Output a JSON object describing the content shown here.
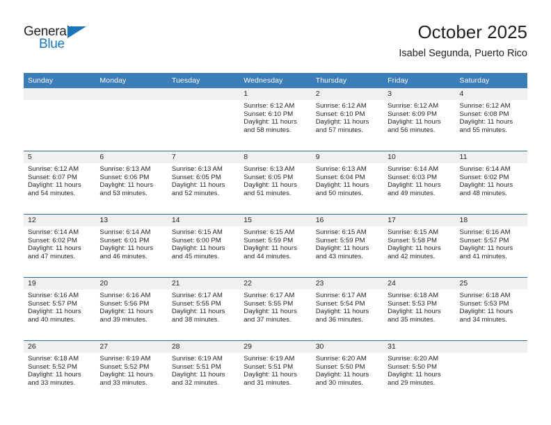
{
  "brand": {
    "name_part1": "General",
    "name_part2": "Blue"
  },
  "header": {
    "title": "October 2025",
    "subtitle": "Isabel Segunda, Puerto Rico"
  },
  "weekday_headers": [
    "Sunday",
    "Monday",
    "Tuesday",
    "Wednesday",
    "Thursday",
    "Friday",
    "Saturday"
  ],
  "colors": {
    "header_blue": "#3b7cb9",
    "row_divider_blue": "#2e6da4",
    "daynum_band": "#f0f0f0",
    "brand_blue": "#1b75bb",
    "text": "#231f20"
  },
  "weeks": [
    [
      {
        "day": "",
        "empty": true
      },
      {
        "day": "",
        "empty": true
      },
      {
        "day": "",
        "empty": true
      },
      {
        "day": "1",
        "sunrise": "Sunrise: 6:12 AM",
        "sunset": "Sunset: 6:10 PM",
        "daylight_line1": "Daylight: 11 hours",
        "daylight_line2": "and 58 minutes."
      },
      {
        "day": "2",
        "sunrise": "Sunrise: 6:12 AM",
        "sunset": "Sunset: 6:10 PM",
        "daylight_line1": "Daylight: 11 hours",
        "daylight_line2": "and 57 minutes."
      },
      {
        "day": "3",
        "sunrise": "Sunrise: 6:12 AM",
        "sunset": "Sunset: 6:09 PM",
        "daylight_line1": "Daylight: 11 hours",
        "daylight_line2": "and 56 minutes."
      },
      {
        "day": "4",
        "sunrise": "Sunrise: 6:12 AM",
        "sunset": "Sunset: 6:08 PM",
        "daylight_line1": "Daylight: 11 hours",
        "daylight_line2": "and 55 minutes."
      }
    ],
    [
      {
        "day": "5",
        "sunrise": "Sunrise: 6:12 AM",
        "sunset": "Sunset: 6:07 PM",
        "daylight_line1": "Daylight: 11 hours",
        "daylight_line2": "and 54 minutes."
      },
      {
        "day": "6",
        "sunrise": "Sunrise: 6:13 AM",
        "sunset": "Sunset: 6:06 PM",
        "daylight_line1": "Daylight: 11 hours",
        "daylight_line2": "and 53 minutes."
      },
      {
        "day": "7",
        "sunrise": "Sunrise: 6:13 AM",
        "sunset": "Sunset: 6:05 PM",
        "daylight_line1": "Daylight: 11 hours",
        "daylight_line2": "and 52 minutes."
      },
      {
        "day": "8",
        "sunrise": "Sunrise: 6:13 AM",
        "sunset": "Sunset: 6:05 PM",
        "daylight_line1": "Daylight: 11 hours",
        "daylight_line2": "and 51 minutes."
      },
      {
        "day": "9",
        "sunrise": "Sunrise: 6:13 AM",
        "sunset": "Sunset: 6:04 PM",
        "daylight_line1": "Daylight: 11 hours",
        "daylight_line2": "and 50 minutes."
      },
      {
        "day": "10",
        "sunrise": "Sunrise: 6:14 AM",
        "sunset": "Sunset: 6:03 PM",
        "daylight_line1": "Daylight: 11 hours",
        "daylight_line2": "and 49 minutes."
      },
      {
        "day": "11",
        "sunrise": "Sunrise: 6:14 AM",
        "sunset": "Sunset: 6:02 PM",
        "daylight_line1": "Daylight: 11 hours",
        "daylight_line2": "and 48 minutes."
      }
    ],
    [
      {
        "day": "12",
        "sunrise": "Sunrise: 6:14 AM",
        "sunset": "Sunset: 6:02 PM",
        "daylight_line1": "Daylight: 11 hours",
        "daylight_line2": "and 47 minutes."
      },
      {
        "day": "13",
        "sunrise": "Sunrise: 6:14 AM",
        "sunset": "Sunset: 6:01 PM",
        "daylight_line1": "Daylight: 11 hours",
        "daylight_line2": "and 46 minutes."
      },
      {
        "day": "14",
        "sunrise": "Sunrise: 6:15 AM",
        "sunset": "Sunset: 6:00 PM",
        "daylight_line1": "Daylight: 11 hours",
        "daylight_line2": "and 45 minutes."
      },
      {
        "day": "15",
        "sunrise": "Sunrise: 6:15 AM",
        "sunset": "Sunset: 5:59 PM",
        "daylight_line1": "Daylight: 11 hours",
        "daylight_line2": "and 44 minutes."
      },
      {
        "day": "16",
        "sunrise": "Sunrise: 6:15 AM",
        "sunset": "Sunset: 5:59 PM",
        "daylight_line1": "Daylight: 11 hours",
        "daylight_line2": "and 43 minutes."
      },
      {
        "day": "17",
        "sunrise": "Sunrise: 6:15 AM",
        "sunset": "Sunset: 5:58 PM",
        "daylight_line1": "Daylight: 11 hours",
        "daylight_line2": "and 42 minutes."
      },
      {
        "day": "18",
        "sunrise": "Sunrise: 6:16 AM",
        "sunset": "Sunset: 5:57 PM",
        "daylight_line1": "Daylight: 11 hours",
        "daylight_line2": "and 41 minutes."
      }
    ],
    [
      {
        "day": "19",
        "sunrise": "Sunrise: 6:16 AM",
        "sunset": "Sunset: 5:57 PM",
        "daylight_line1": "Daylight: 11 hours",
        "daylight_line2": "and 40 minutes."
      },
      {
        "day": "20",
        "sunrise": "Sunrise: 6:16 AM",
        "sunset": "Sunset: 5:56 PM",
        "daylight_line1": "Daylight: 11 hours",
        "daylight_line2": "and 39 minutes."
      },
      {
        "day": "21",
        "sunrise": "Sunrise: 6:17 AM",
        "sunset": "Sunset: 5:55 PM",
        "daylight_line1": "Daylight: 11 hours",
        "daylight_line2": "and 38 minutes."
      },
      {
        "day": "22",
        "sunrise": "Sunrise: 6:17 AM",
        "sunset": "Sunset: 5:55 PM",
        "daylight_line1": "Daylight: 11 hours",
        "daylight_line2": "and 37 minutes."
      },
      {
        "day": "23",
        "sunrise": "Sunrise: 6:17 AM",
        "sunset": "Sunset: 5:54 PM",
        "daylight_line1": "Daylight: 11 hours",
        "daylight_line2": "and 36 minutes."
      },
      {
        "day": "24",
        "sunrise": "Sunrise: 6:18 AM",
        "sunset": "Sunset: 5:53 PM",
        "daylight_line1": "Daylight: 11 hours",
        "daylight_line2": "and 35 minutes."
      },
      {
        "day": "25",
        "sunrise": "Sunrise: 6:18 AM",
        "sunset": "Sunset: 5:53 PM",
        "daylight_line1": "Daylight: 11 hours",
        "daylight_line2": "and 34 minutes."
      }
    ],
    [
      {
        "day": "26",
        "sunrise": "Sunrise: 6:18 AM",
        "sunset": "Sunset: 5:52 PM",
        "daylight_line1": "Daylight: 11 hours",
        "daylight_line2": "and 33 minutes."
      },
      {
        "day": "27",
        "sunrise": "Sunrise: 6:19 AM",
        "sunset": "Sunset: 5:52 PM",
        "daylight_line1": "Daylight: 11 hours",
        "daylight_line2": "and 33 minutes."
      },
      {
        "day": "28",
        "sunrise": "Sunrise: 6:19 AM",
        "sunset": "Sunset: 5:51 PM",
        "daylight_line1": "Daylight: 11 hours",
        "daylight_line2": "and 32 minutes."
      },
      {
        "day": "29",
        "sunrise": "Sunrise: 6:19 AM",
        "sunset": "Sunset: 5:51 PM",
        "daylight_line1": "Daylight: 11 hours",
        "daylight_line2": "and 31 minutes."
      },
      {
        "day": "30",
        "sunrise": "Sunrise: 6:20 AM",
        "sunset": "Sunset: 5:50 PM",
        "daylight_line1": "Daylight: 11 hours",
        "daylight_line2": "and 30 minutes."
      },
      {
        "day": "31",
        "sunrise": "Sunrise: 6:20 AM",
        "sunset": "Sunset: 5:50 PM",
        "daylight_line1": "Daylight: 11 hours",
        "daylight_line2": "and 29 minutes."
      },
      {
        "day": "",
        "empty": true
      }
    ]
  ]
}
